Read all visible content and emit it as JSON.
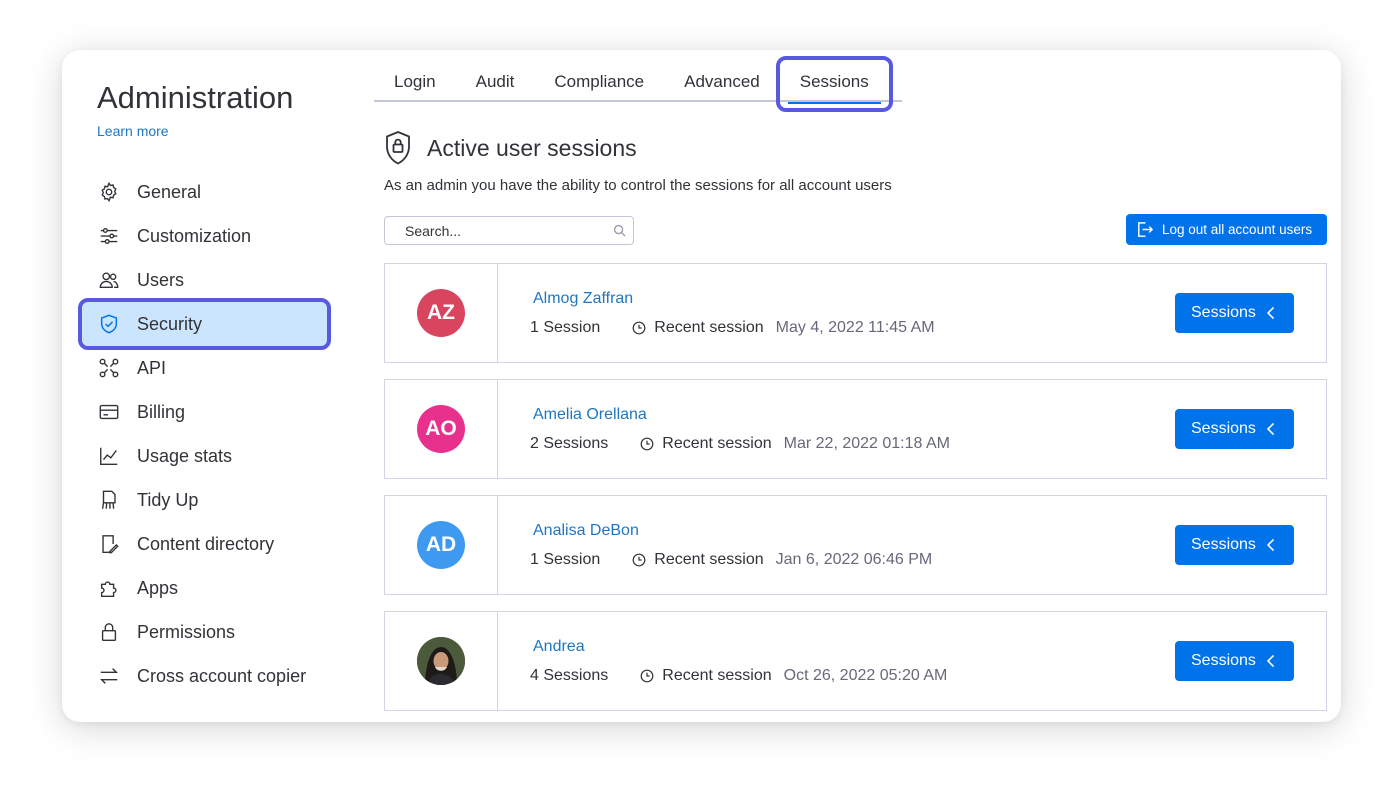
{
  "sidebar": {
    "title": "Administration",
    "learn_more": "Learn more",
    "items": [
      {
        "label": "General",
        "icon": "gear-icon"
      },
      {
        "label": "Customization",
        "icon": "sliders-icon"
      },
      {
        "label": "Users",
        "icon": "users-icon"
      },
      {
        "label": "Security",
        "icon": "shield-icon",
        "active": true
      },
      {
        "label": "API",
        "icon": "api-icon"
      },
      {
        "label": "Billing",
        "icon": "credit-card-icon"
      },
      {
        "label": "Usage stats",
        "icon": "chart-icon"
      },
      {
        "label": "Tidy Up",
        "icon": "tidy-up-icon"
      },
      {
        "label": "Content directory",
        "icon": "content-directory-icon"
      },
      {
        "label": "Apps",
        "icon": "puzzle-icon"
      },
      {
        "label": "Permissions",
        "icon": "lock-icon"
      },
      {
        "label": "Cross account copier",
        "icon": "swap-arrows-icon"
      }
    ]
  },
  "tabs": [
    {
      "label": "Login"
    },
    {
      "label": "Audit"
    },
    {
      "label": "Compliance"
    },
    {
      "label": "Advanced"
    },
    {
      "label": "Sessions",
      "active": true
    }
  ],
  "main": {
    "title": "Active user sessions",
    "subtitle": "As an admin you have the ability to control the sessions for all account users",
    "search_placeholder": "Search...",
    "logout_all_label": "Log out all account users",
    "recent_session_label": "Recent session",
    "sessions_button_label": "Sessions"
  },
  "users": [
    {
      "name": "Almog Zaffran",
      "initials": "AZ",
      "avatar_color": "#d9455f",
      "sessions": "1 Session",
      "recent": "May 4, 2022 11:45 AM"
    },
    {
      "name": "Amelia Orellana",
      "initials": "AO",
      "avatar_color": "#e8318d",
      "sessions": "2 Sessions",
      "recent": "Mar 22, 2022 01:18 AM"
    },
    {
      "name": "Analisa DeBon",
      "initials": "AD",
      "avatar_color": "#3d9af0",
      "sessions": "1 Session",
      "recent": "Jan 6, 2022 06:46 PM"
    },
    {
      "name": "Andrea",
      "initials": "",
      "avatar_color": "#3a3a3a",
      "sessions": "4 Sessions",
      "recent": "Oct 26, 2022 05:20 AM",
      "photo": true
    }
  ],
  "colors": {
    "accent": "#0073ea",
    "highlight": "#5959e0",
    "link": "#1f76c2",
    "active_bg": "#cce5ff"
  }
}
